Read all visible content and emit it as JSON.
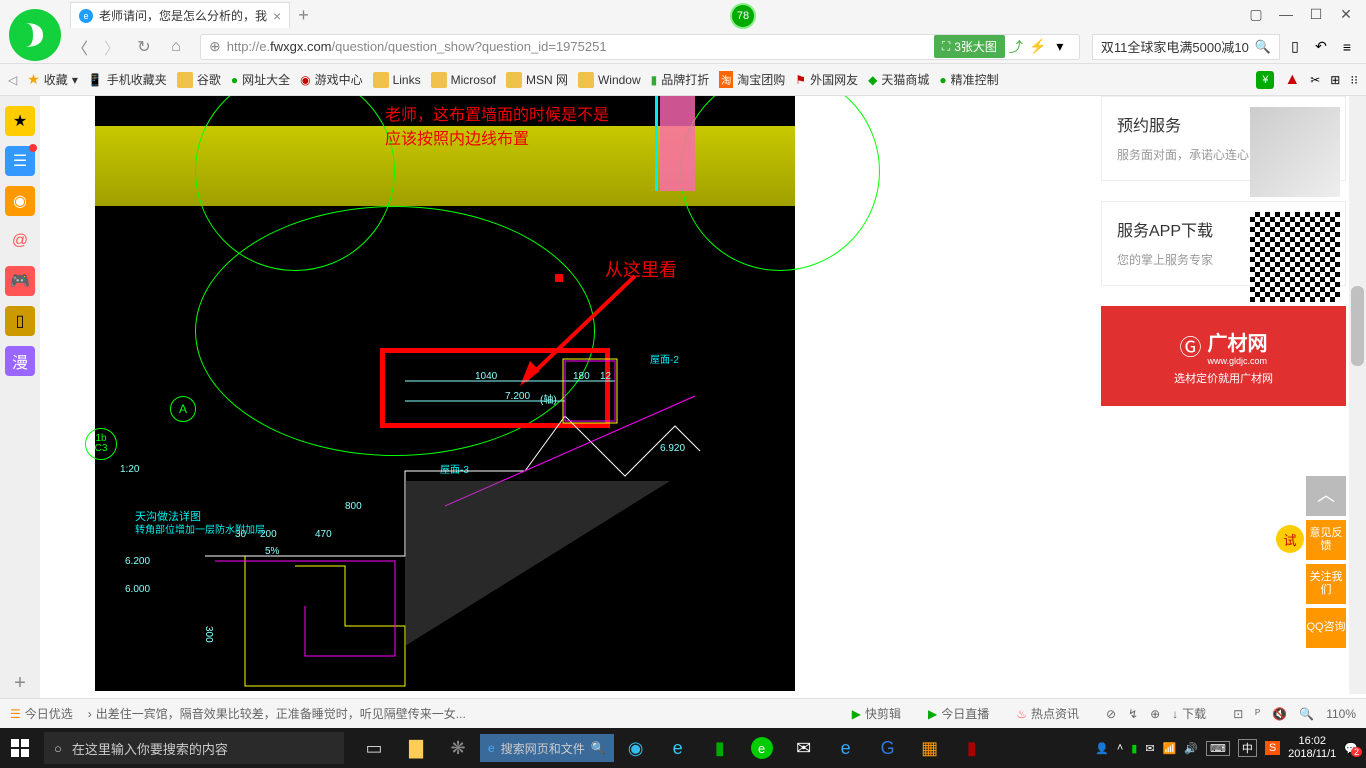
{
  "titlebar": {
    "tab_title": "老师请问，您是怎么分析的，我",
    "badge": "78",
    "new_tab": "+"
  },
  "addressbar": {
    "url_prefix": "http://e.",
    "url_domain": "fwxgx.com",
    "url_path": "/question/question_show?question_id=1975251",
    "pic_label": "3张大图",
    "search_text": "双11全球家电满5000减10"
  },
  "bookbar": {
    "favorites": "收藏",
    "items": [
      "手机收藏夹",
      "谷歌",
      "网址大全",
      "游戏中心",
      "Links",
      "Microsof",
      "MSN 网",
      "Window",
      "品牌打折",
      "淘宝团购",
      "外国网友",
      "天猫商城",
      "精准控制"
    ]
  },
  "cad": {
    "red1a": "老师，这布置墙面的时候是不是",
    "red1b": "应该按照内边线布置",
    "red2": "从这里看",
    "dim1": "1040",
    "dim2": "180",
    "dim3": "12",
    "dim4": "7.200",
    "dim5": "(轴)",
    "dim_800": "800",
    "dim_30": "30",
    "dim_200": "200",
    "dim_470": "470",
    "dim_300": "300",
    "dim_6200": "6.200",
    "dim_6000": "6.000",
    "dim_6920": "6.920",
    "dim_120": "1:20",
    "roof2": "屋面-2",
    "roof3": "屋面-3",
    "node_text1": "天沟做法详图",
    "node_text2": "转角部位增加一层防水附加层",
    "label_a": "A",
    "label_1b": "1b",
    "label_c3": "C3",
    "pct": "5%"
  },
  "right": {
    "card1_title": "预约服务",
    "card1_text": "服务面对面，承诺心连心",
    "card2_title": "服务APP下载",
    "card2_text": "您的掌上服务专家",
    "ad_title": "广材网",
    "ad_url": "www.gldjc.com",
    "ad_sub": "选材定价就用广材网",
    "float": [
      "意见反馈",
      "关注我们",
      "QQ咨询"
    ],
    "float_try": "试"
  },
  "statusbar": {
    "today": "今日优选",
    "news": "出差住一宾馆，隔音效果比较差，正准备睡觉时，听见隔壁传来一女...",
    "items": [
      "快剪辑",
      "今日直播",
      "热点资讯",
      "下载",
      "110%"
    ]
  },
  "taskbar": {
    "search_placeholder": "在这里输入你要搜索的内容",
    "edge_search": "搜索网页和文件",
    "ime": "中",
    "time": "16:02",
    "date": "2018/11/1",
    "notif": "2"
  }
}
